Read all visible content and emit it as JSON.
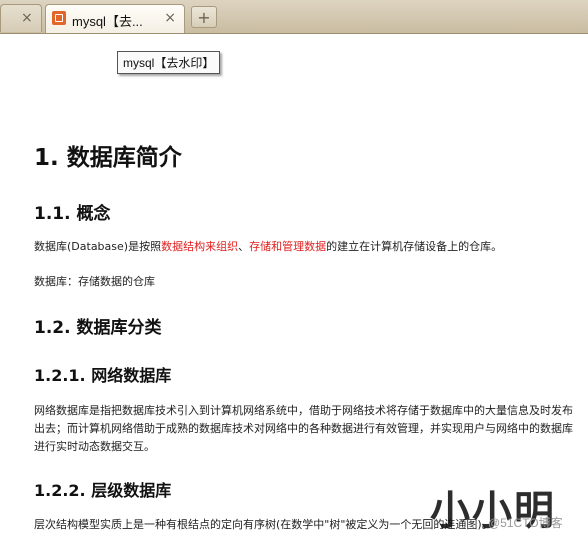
{
  "tabs": [
    {
      "title": "",
      "close": "×"
    },
    {
      "title": "mysql【去...",
      "close": "×"
    }
  ],
  "new_tab": "+",
  "tooltip": "mysql【去水印】",
  "doc": {
    "h1": "1. 数据库简介",
    "s1_title": "1.1. 概念",
    "s1_p1_a": "数据库(Database)是按照",
    "s1_p1_b": "数据结构来组织",
    "s1_p1_c": "、",
    "s1_p1_d": "存储和管理数据",
    "s1_p1_e": "的建立在计算机存储设备上的仓库。",
    "s1_p2": "数据库：存储数据的仓库",
    "s2_title": "1.2. 数据库分类",
    "s21_title": "1.2.1. 网络数据库",
    "s21_p": "网络数据库是指把数据库技术引入到计算机网络系统中，借助于网络技术将存储于数据库中的大量信息及时发布出去；而计算机网络借助于成熟的数据库技术对网络中的各种数据进行有效管理，并实现用户与网络中的数据库进行实时动态数据交互。",
    "s22_title": "1.2.2. 层级数据库",
    "s22_p": "层次结构模型实质上是一种有根结点的定向有序树(在数学中\"树\"被定义为一个无回的连通图)。"
  },
  "watermark": "小小明",
  "watermark_sub": "@51CTO博客"
}
